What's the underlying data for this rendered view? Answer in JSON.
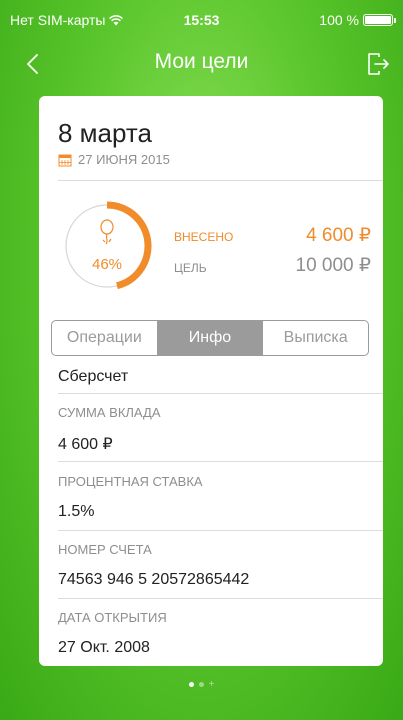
{
  "status_bar": {
    "carrier": "Нет SIM-карты",
    "time": "15:53",
    "battery": "100 %",
    "battery_level": 1.0
  },
  "nav": {
    "title": "Мои цели",
    "back_icon": "chevron-left-icon",
    "exit_icon": "exit-icon"
  },
  "goal": {
    "title": "8 марта",
    "date": "27 ИЮНЯ 2015",
    "progress_percent_label": "46%",
    "progress_fraction": 0.46,
    "deposited_label": "ВНЕСЕНО",
    "deposited_value": "4 600 ₽",
    "target_label": "ЦЕЛЬ",
    "target_value": "10 000 ₽"
  },
  "tabs": [
    {
      "label": "Операции",
      "active": false
    },
    {
      "label": "Инфо",
      "active": true
    },
    {
      "label": "Выписка",
      "active": false
    }
  ],
  "info": {
    "account_type": "Сберсчет",
    "fields": [
      {
        "label": "СУММА ВКЛАДА",
        "value": "4 600 ₽"
      },
      {
        "label": "ПРОЦЕНТНАЯ СТАВКА",
        "value": "1.5%"
      },
      {
        "label": "НОМЕР СЧЕТА",
        "value": "74563 946 5 20572865442"
      },
      {
        "label": "ДАТА ОТКРЫТИЯ",
        "value": "27 Окт. 2008"
      }
    ]
  },
  "colors": {
    "accent_orange": "#f08c2a",
    "background_green": "#5cc72e",
    "tab_active_gray": "#9b9b9b"
  },
  "page_indicator": {
    "pages": 3,
    "current": 1
  }
}
